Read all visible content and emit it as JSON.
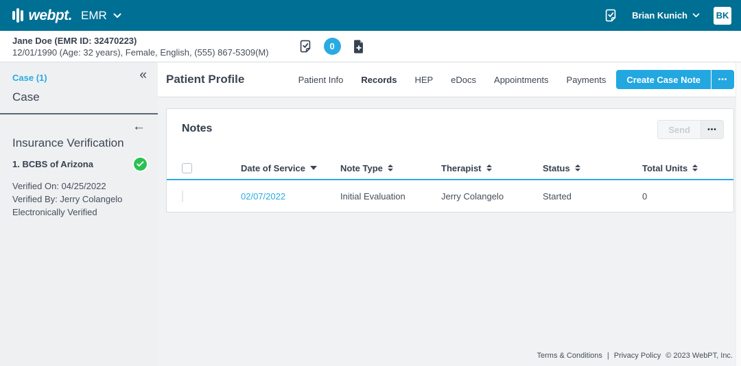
{
  "topbar": {
    "brand": "webpt.",
    "product": "EMR",
    "user_name": "Brian Kunich",
    "user_initials": "BK"
  },
  "patient_bar": {
    "name_line": "Jane Doe (EMR ID: 32470223)",
    "details_line": "12/01/1990 (Age: 32 years), Female, English, (555) 867-5309(M)",
    "badge_count": "0"
  },
  "sidebar": {
    "case_link": "Case (1)",
    "case_title": "Case",
    "section_title": "Insurance Verification",
    "insurance_name": "1. BCBS of Arizona",
    "verified_on": "Verified On: 04/25/2022",
    "verified_by": "Verified By: Jerry Colangelo",
    "verified_method": "Electronically Verified"
  },
  "main": {
    "page_title": "Patient Profile",
    "tabs": [
      {
        "label": "Patient Info",
        "active": false
      },
      {
        "label": "Records",
        "active": true
      },
      {
        "label": "HEP",
        "active": false
      },
      {
        "label": "eDocs",
        "active": false
      },
      {
        "label": "Appointments",
        "active": false
      },
      {
        "label": "Payments",
        "active": false
      }
    ],
    "create_button_label": "Create Case Note"
  },
  "notes": {
    "title": "Notes",
    "send_button_label": "Send",
    "table": {
      "columns": [
        {
          "label": "Date of Service",
          "sort": "desc"
        },
        {
          "label": "Note Type",
          "sort": "both"
        },
        {
          "label": "Therapist",
          "sort": "both"
        },
        {
          "label": "Status",
          "sort": "both"
        },
        {
          "label": "Total Units",
          "sort": "both"
        }
      ],
      "rows": [
        {
          "date_of_service": "02/07/2022",
          "note_type": "Initial Evaluation",
          "therapist": "Jerry Colangelo",
          "status": "Started",
          "total_units": "0"
        }
      ]
    }
  },
  "footer": {
    "terms_label": "Terms & Conditions",
    "separator": "|",
    "privacy_label": "Privacy Policy",
    "copyright": "© 2023 WebPT, Inc."
  },
  "icons": {
    "collapse_glyph": "«",
    "back_glyph": "←",
    "ellipsis_glyph": "•••"
  },
  "colors": {
    "header_teal": "#006f94",
    "accent_blue": "#29abe2",
    "success_green": "#2bc152",
    "text_navy": "#36414f"
  }
}
